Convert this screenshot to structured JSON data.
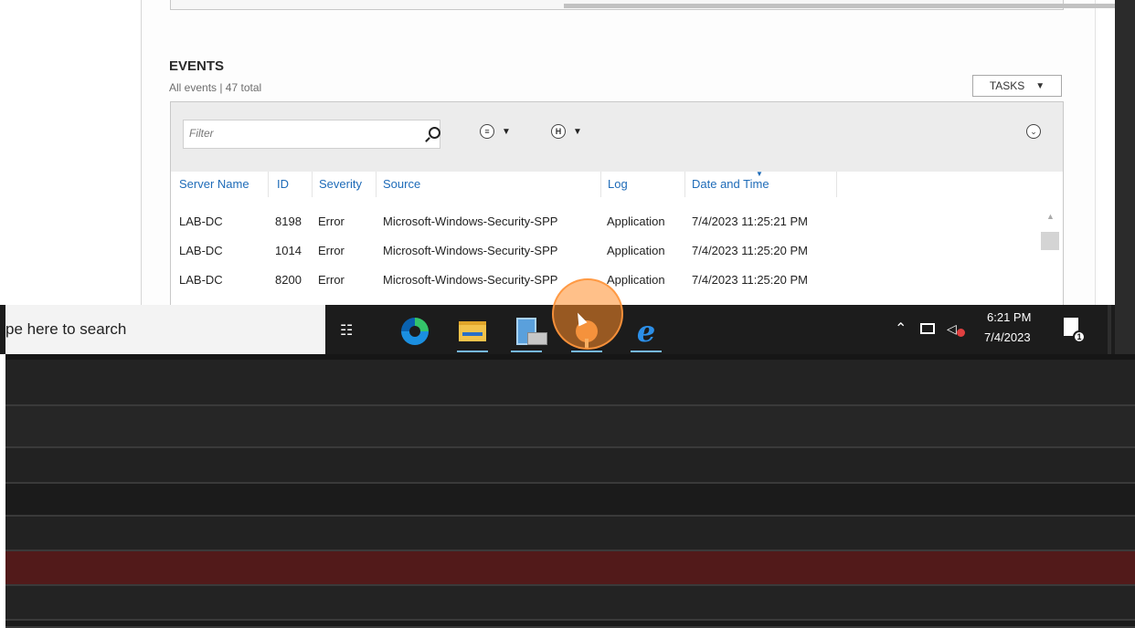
{
  "events": {
    "title": "EVENTS",
    "subtitle": "All events | 47 total",
    "tasks_label": "TASKS",
    "filter_placeholder": "Filter",
    "columns": [
      "Server Name",
      "ID",
      "Severity",
      "Source",
      "Log",
      "Date and Time"
    ],
    "rows": [
      {
        "server": "LAB-DC",
        "id": "8198",
        "severity": "Error",
        "source": "Microsoft-Windows-Security-SPP",
        "log": "Application",
        "datetime": "7/4/2023 11:25:21 PM"
      },
      {
        "server": "LAB-DC",
        "id": "1014",
        "severity": "Error",
        "source": "Microsoft-Windows-Security-SPP",
        "log": "Application",
        "datetime": "7/4/2023 11:25:20 PM"
      },
      {
        "server": "LAB-DC",
        "id": "8200",
        "severity": "Error",
        "source": "Microsoft-Windows-Security-SPP",
        "log": "Application",
        "datetime": "7/4/2023 11:25:20 PM"
      }
    ]
  },
  "taskbar": {
    "search_text": "pe here to search",
    "apps": [
      "task-view",
      "edge",
      "file-explorer",
      "server-manager",
      "troubleshooter",
      "internet-explorer"
    ],
    "clock_time": "6:21 PM",
    "clock_date": "7/4/2023",
    "notification_count": "1"
  },
  "colors": {
    "accent": "#1e6bb8",
    "taskbar": "#1c1c1c",
    "highlight": "#ff8c28",
    "red_band": "#521a1a"
  },
  "lower_bands": [
    {
      "color": "#232323"
    },
    {
      "color": "#262626"
    },
    {
      "color": "#222222"
    },
    {
      "color": "#1b1b1b"
    },
    {
      "color": "#222222"
    },
    {
      "color": "#521a1a"
    },
    {
      "color": "#232323"
    },
    {
      "color": "#1b1b1b"
    }
  ]
}
